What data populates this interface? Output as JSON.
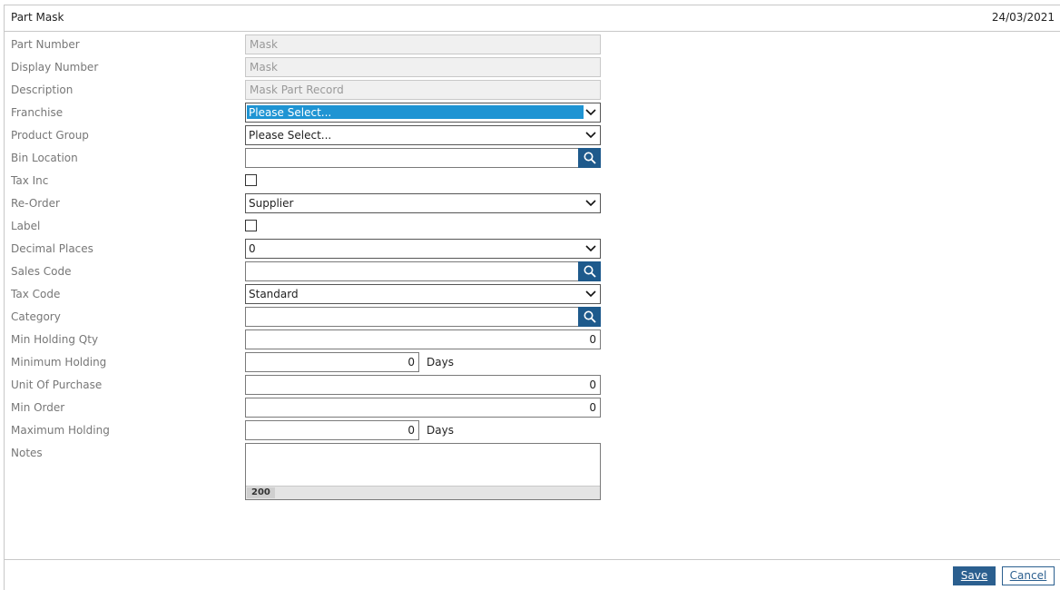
{
  "header": {
    "title": "Part Mask",
    "date": "24/03/2021"
  },
  "fields": {
    "part_number": {
      "label": "Part Number",
      "value": "Mask"
    },
    "display_number": {
      "label": "Display Number",
      "value": "Mask"
    },
    "description": {
      "label": "Description",
      "value": "Mask Part Record"
    },
    "franchise": {
      "label": "Franchise",
      "value": "Please Select..."
    },
    "product_group": {
      "label": "Product Group",
      "value": "Please Select..."
    },
    "bin_location": {
      "label": "Bin Location",
      "value": ""
    },
    "tax_inc": {
      "label": "Tax Inc",
      "checked": false
    },
    "re_order": {
      "label": "Re-Order",
      "value": "Supplier"
    },
    "label": {
      "label": "Label",
      "checked": false
    },
    "decimal_places": {
      "label": "Decimal Places",
      "value": "0"
    },
    "sales_code": {
      "label": "Sales Code",
      "value": ""
    },
    "tax_code": {
      "label": "Tax Code",
      "value": "Standard"
    },
    "category": {
      "label": "Category",
      "value": ""
    },
    "min_holding_qty": {
      "label": "Min Holding Qty",
      "value": "0"
    },
    "minimum_holding": {
      "label": "Minimum Holding",
      "value": "0",
      "unit": "Days"
    },
    "unit_of_purchase": {
      "label": "Unit Of Purchase",
      "value": "0"
    },
    "min_order": {
      "label": "Min Order",
      "value": "0"
    },
    "maximum_holding": {
      "label": "Maximum Holding",
      "value": "0",
      "unit": "Days"
    },
    "notes": {
      "label": "Notes",
      "value": "",
      "remaining_chars": "200"
    }
  },
  "actions": {
    "save": "Save",
    "cancel": "Cancel"
  },
  "colors": {
    "accent": "#2b5f8f",
    "highlight": "#1f94d3",
    "lookup_button": "#1e5a8c"
  },
  "icons": {
    "lookup": "search-icon",
    "dropdown": "chevron-down-icon"
  }
}
